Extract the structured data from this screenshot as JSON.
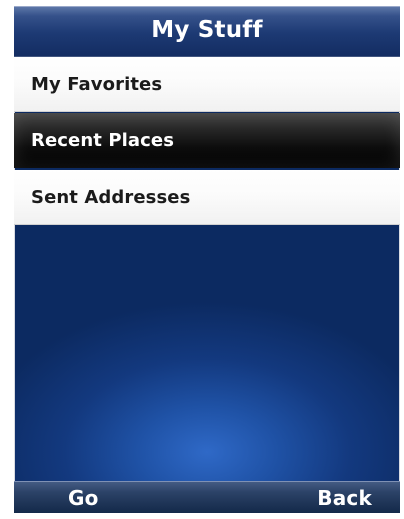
{
  "screen": {
    "title": "My Stuff",
    "menu_items": [
      {
        "label": "My Favorites",
        "state": "normal"
      },
      {
        "label": "Recent Places",
        "state": "selected"
      },
      {
        "label": "Sent Addresses",
        "state": "normal"
      }
    ],
    "softkeys": {
      "left_label": "Go",
      "right_label": "Back"
    },
    "colors": {
      "selection_background": "#000000",
      "menu_background": "#ffffff",
      "screen_blue": "#13397f",
      "text_light": "#ffffff",
      "text_dark": "#1b1b1b"
    }
  }
}
